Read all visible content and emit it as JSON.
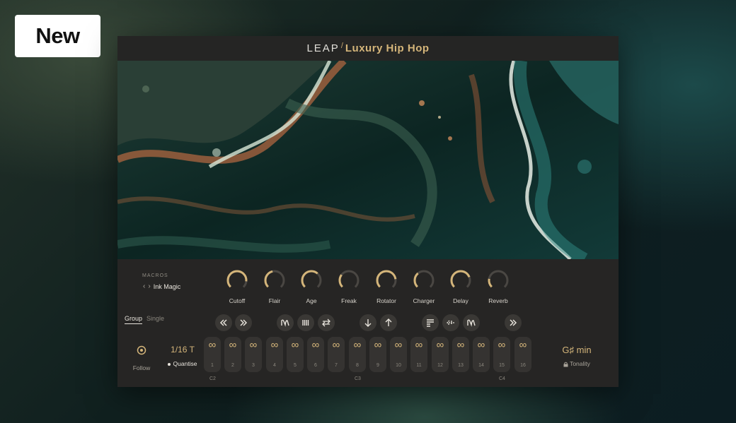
{
  "badge": {
    "label": "New"
  },
  "plugin": {
    "brand": "LEAP",
    "separator": "/",
    "product": "Luxury Hip Hop",
    "accent_color": "#d4b57a"
  },
  "macros": {
    "label": "MACROS",
    "preset_name": "Ink Magic",
    "prev_icon": "chevron-left-icon",
    "next_icon": "chevron-right-icon",
    "knobs": [
      {
        "label": "Cutoff",
        "value": 0.85
      },
      {
        "label": "Flair",
        "value": 0.45
      },
      {
        "label": "Age",
        "value": 0.65
      },
      {
        "label": "Freak",
        "value": 0.3
      },
      {
        "label": "Rotator",
        "value": 0.8
      },
      {
        "label": "Charger",
        "value": 0.35
      },
      {
        "label": "Delay",
        "value": 0.75
      },
      {
        "label": "Reverb",
        "value": 0.2
      }
    ]
  },
  "mode_tabs": {
    "group": "Group",
    "single": "Single"
  },
  "toolbar_icons": [
    "rewind-icon",
    "fast-forward-icon",
    "envelope-icon",
    "bars-icon",
    "swap-icon",
    "arrow-down-icon",
    "arrow-up-icon",
    "list-icon",
    "reverse-icon",
    "envelope-icon",
    "fast-forward-icon"
  ],
  "follow": {
    "label": "Follow",
    "icon": "dial-icon"
  },
  "rate": {
    "value": "1/16 T",
    "quantise_label": "Quantise"
  },
  "pads": [
    "1",
    "2",
    "3",
    "4",
    "5",
    "6",
    "7",
    "8",
    "9",
    "10",
    "11",
    "12",
    "13",
    "14",
    "15",
    "16"
  ],
  "pad_icon": "infinity-icon",
  "notes": [
    "C2",
    "C3",
    "C4"
  ],
  "tonality": {
    "key": "G♯ min",
    "label": "Tonality",
    "icon": "lock-icon"
  }
}
